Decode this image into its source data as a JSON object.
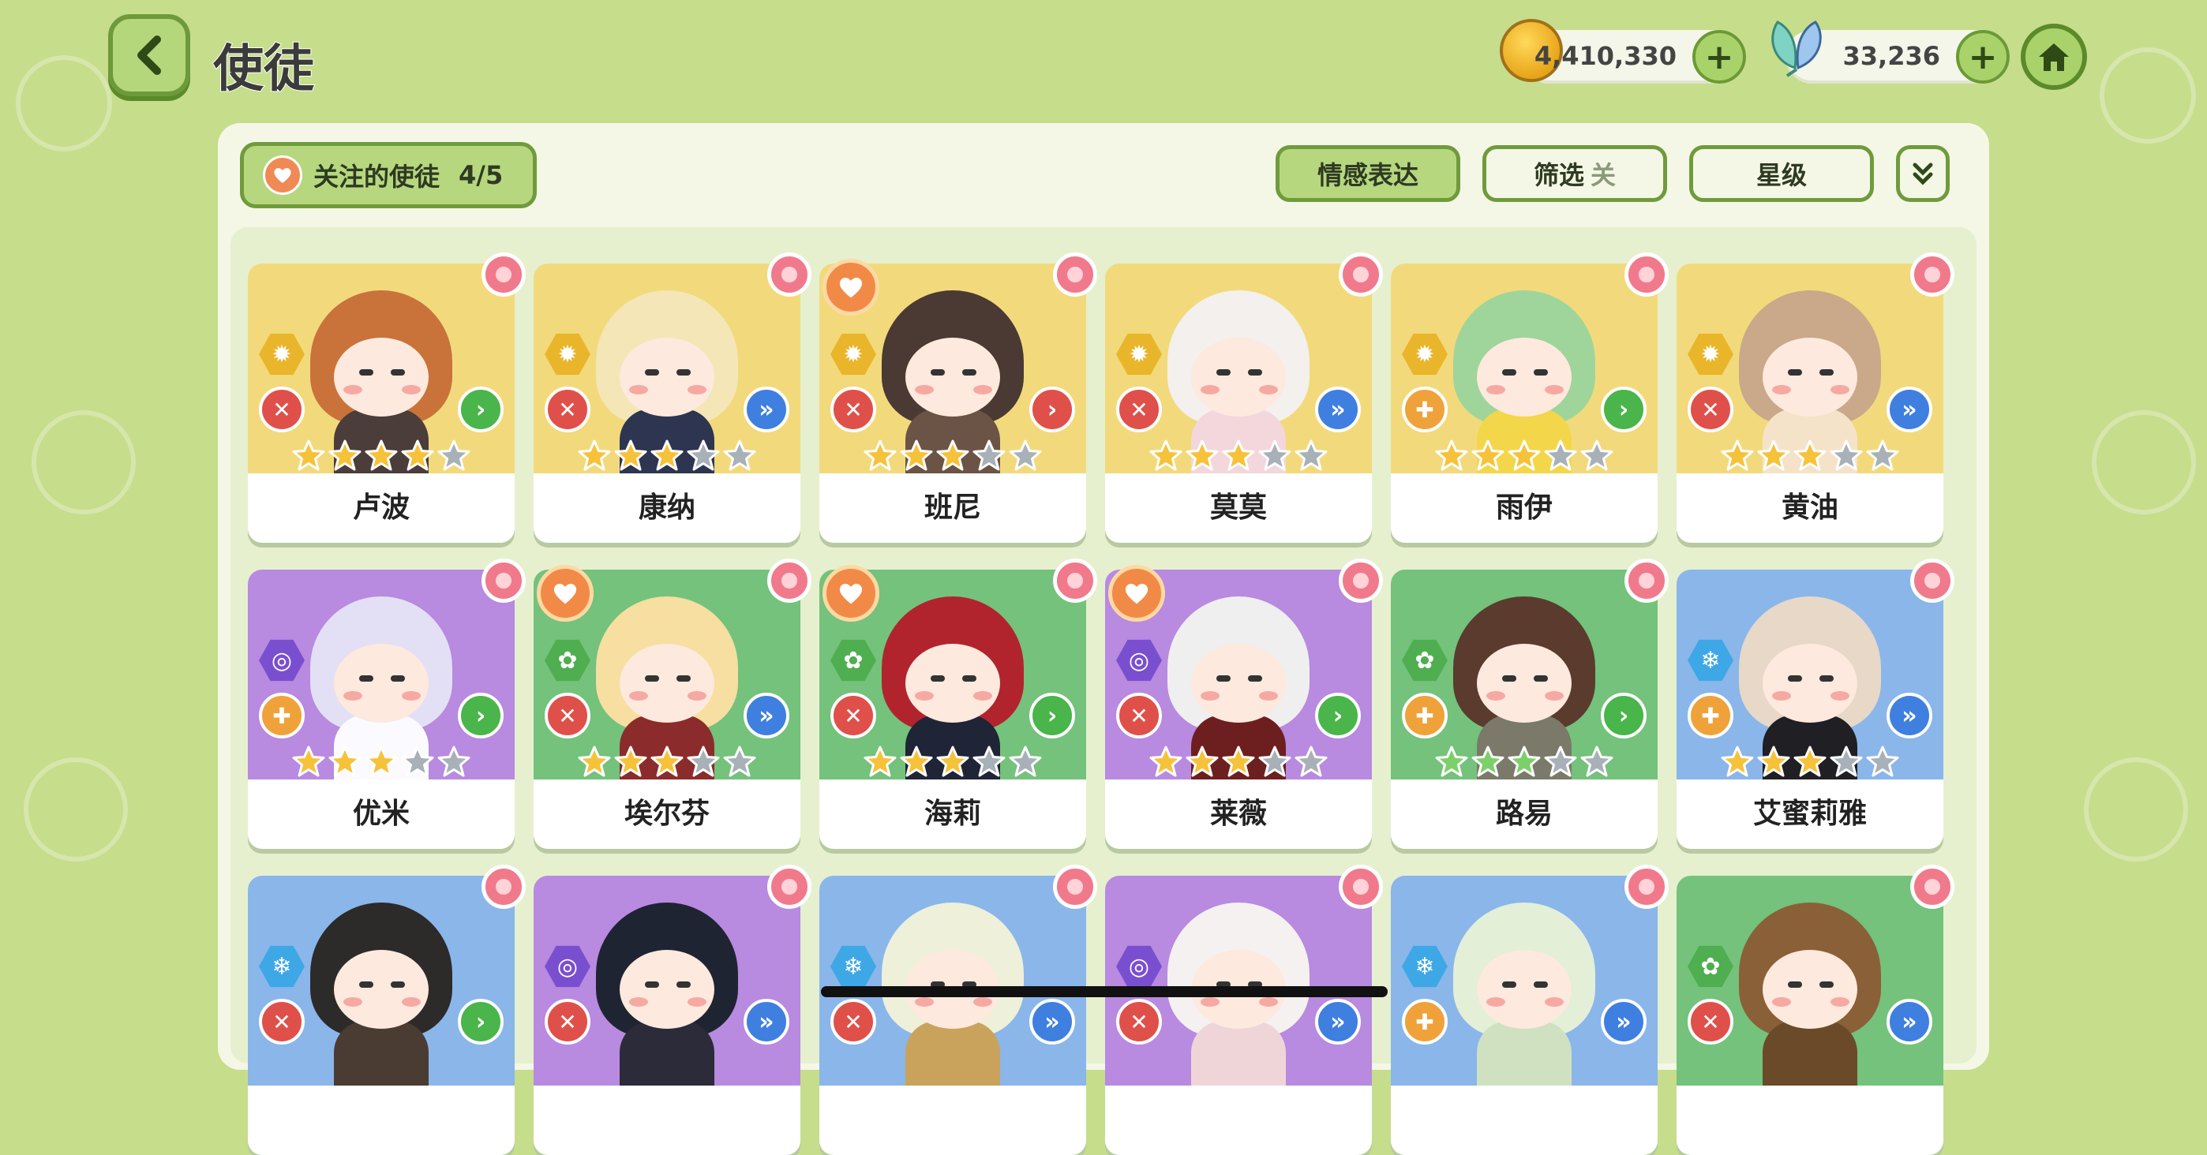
{
  "header": {
    "title": "使徒",
    "gold_amount": "4,410,330",
    "gem_amount": "33,236",
    "plus_label": "+"
  },
  "toolbar": {
    "follow_label": "关注的使徒",
    "follow_count": "4/5",
    "emotion_label": "情感表达",
    "filter_label": "筛选",
    "filter_state": "关",
    "star_label": "星级"
  },
  "colors": {
    "gold_bg": "#f2da7c",
    "purple_bg": "#b88ae0",
    "green_bg": "#74c27c",
    "blue_bg": "#8ab6ea",
    "accent_green": "#6f9b3c",
    "star_gold": "#f6c23a",
    "star_green": "#7cd06a",
    "star_gray": "#a8b0b8"
  },
  "apostles": [
    {
      "name": "卢波",
      "bg": "gold",
      "element": "sun",
      "role": "attack",
      "arrow": "green",
      "stars": 4,
      "star_color": "gold",
      "favorite": false,
      "hair": "#c9733a",
      "body": "#4b3d3a"
    },
    {
      "name": "康纳",
      "bg": "gold",
      "element": "sun",
      "role": "attack",
      "arrow": "blue",
      "stars": 3,
      "star_color": "gold",
      "favorite": false,
      "hair": "#f5e6b8",
      "body": "#2e3550"
    },
    {
      "name": "班尼",
      "bg": "gold",
      "element": "sun",
      "role": "attack",
      "arrow": "red",
      "stars": 3,
      "star_color": "gold",
      "favorite": true,
      "hair": "#4a3a33",
      "body": "#6b5446"
    },
    {
      "name": "莫莫",
      "bg": "gold",
      "element": "sun",
      "role": "attack",
      "arrow": "blue",
      "stars": 3,
      "star_color": "gold",
      "favorite": false,
      "hair": "#f3f0ee",
      "body": "#f3d7dc"
    },
    {
      "name": "雨伊",
      "bg": "gold",
      "element": "sun",
      "role": "support",
      "arrow": "green",
      "stars": 3,
      "star_color": "gold",
      "favorite": false,
      "hair": "#9fd59a",
      "body": "#f3d64a"
    },
    {
      "name": "黄油",
      "bg": "gold",
      "element": "sun",
      "role": "attack",
      "arrow": "blue",
      "stars": 3,
      "star_color": "gold",
      "favorite": false,
      "hair": "#c9a98a",
      "body": "#f5e3c9"
    },
    {
      "name": "优米",
      "bg": "purple",
      "element": "swirl",
      "role": "support",
      "arrow": "green",
      "stars": 3,
      "star_color": "gold",
      "favorite": false,
      "hair": "#e3e0f5",
      "body": "#fbfbff"
    },
    {
      "name": "埃尔芬",
      "bg": "green",
      "element": "leaf",
      "role": "attack",
      "arrow": "blue",
      "stars": 3,
      "star_color": "gold",
      "favorite": true,
      "hair": "#f6dfa0",
      "body": "#8c2b2b"
    },
    {
      "name": "海莉",
      "bg": "green",
      "element": "leaf",
      "role": "attack",
      "arrow": "green",
      "stars": 3,
      "star_color": "gold",
      "favorite": true,
      "hair": "#b1242e",
      "body": "#1f2436"
    },
    {
      "name": "莱薇",
      "bg": "purple",
      "element": "swirl",
      "role": "attack",
      "arrow": "green",
      "stars": 3,
      "star_color": "gold",
      "favorite": true,
      "hair": "#efefef",
      "body": "#6d1f1f"
    },
    {
      "name": "路易",
      "bg": "green",
      "element": "leaf",
      "role": "support",
      "arrow": "green",
      "stars": 3,
      "star_color": "green",
      "favorite": false,
      "hair": "#5b3b2e",
      "body": "#7b7a6a"
    },
    {
      "name": "艾蜜莉雅",
      "bg": "blue",
      "element": "snow",
      "role": "support",
      "arrow": "blue",
      "stars": 3,
      "star_color": "gold",
      "favorite": false,
      "hair": "#e7d8c8",
      "body": "#1f1f24"
    },
    {
      "name": "",
      "bg": "blue",
      "element": "snow",
      "role": "attack",
      "arrow": "green",
      "stars": 0,
      "star_color": "gold",
      "favorite": false,
      "hair": "#2d2a2a",
      "body": "#4a3b33"
    },
    {
      "name": "",
      "bg": "purple",
      "element": "swirl",
      "role": "attack",
      "arrow": "blue",
      "stars": 0,
      "star_color": "gold",
      "favorite": false,
      "hair": "#1f2433",
      "body": "#2b2b3a"
    },
    {
      "name": "",
      "bg": "blue",
      "element": "snow",
      "role": "attack",
      "arrow": "blue",
      "stars": 0,
      "star_color": "gold",
      "favorite": false,
      "hair": "#eef0d9",
      "body": "#c9a35c"
    },
    {
      "name": "",
      "bg": "purple",
      "element": "swirl",
      "role": "attack",
      "arrow": "blue",
      "stars": 0,
      "star_color": "gold",
      "favorite": false,
      "hair": "#f4f1f0",
      "body": "#f0d5d8"
    },
    {
      "name": "",
      "bg": "blue",
      "element": "snow",
      "role": "support",
      "arrow": "blue",
      "stars": 0,
      "star_color": "gold",
      "favorite": false,
      "hair": "#e3efd7",
      "body": "#cfe1c1"
    },
    {
      "name": "",
      "bg": "green",
      "element": "leaf",
      "role": "attack",
      "arrow": "blue",
      "stars": 0,
      "star_color": "gold",
      "favorite": false,
      "hair": "#8a6038",
      "body": "#6b4a2a"
    }
  ]
}
